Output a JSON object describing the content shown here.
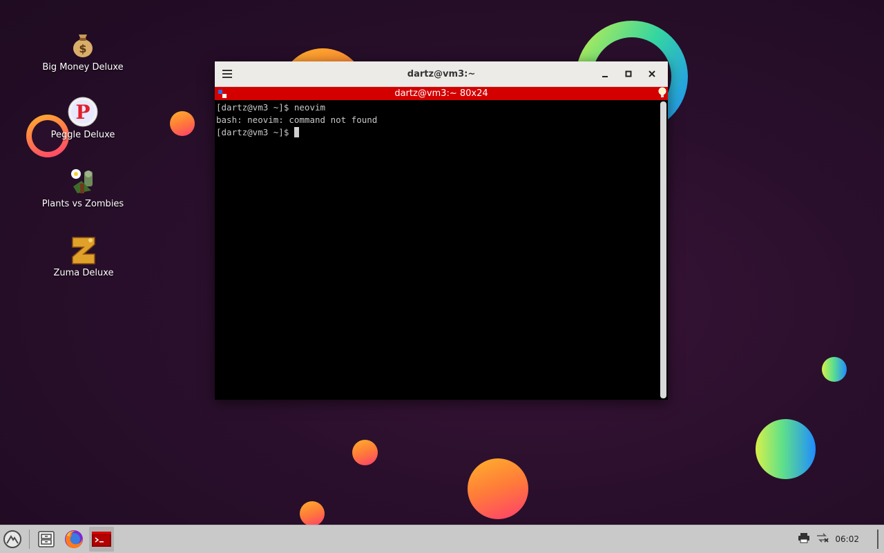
{
  "desktop": {
    "icons": [
      {
        "label": "Big Money Deluxe"
      },
      {
        "label": "Peggle Deluxe"
      },
      {
        "label": "Plants vs Zombies"
      },
      {
        "label": "Zuma Deluxe"
      }
    ]
  },
  "window": {
    "title": "dartz@vm3:~",
    "terminal_title": "dartz@vm3:~ 80x24",
    "lines": [
      "[dartz@vm3 ~]$ neovim",
      "bash: neovim: command not found",
      "[dartz@vm3 ~]$ "
    ]
  },
  "taskbar": {
    "clock": "06:02"
  },
  "colors": {
    "terminal_bar": "#d40000",
    "taskbar": "#c9c9c9"
  }
}
